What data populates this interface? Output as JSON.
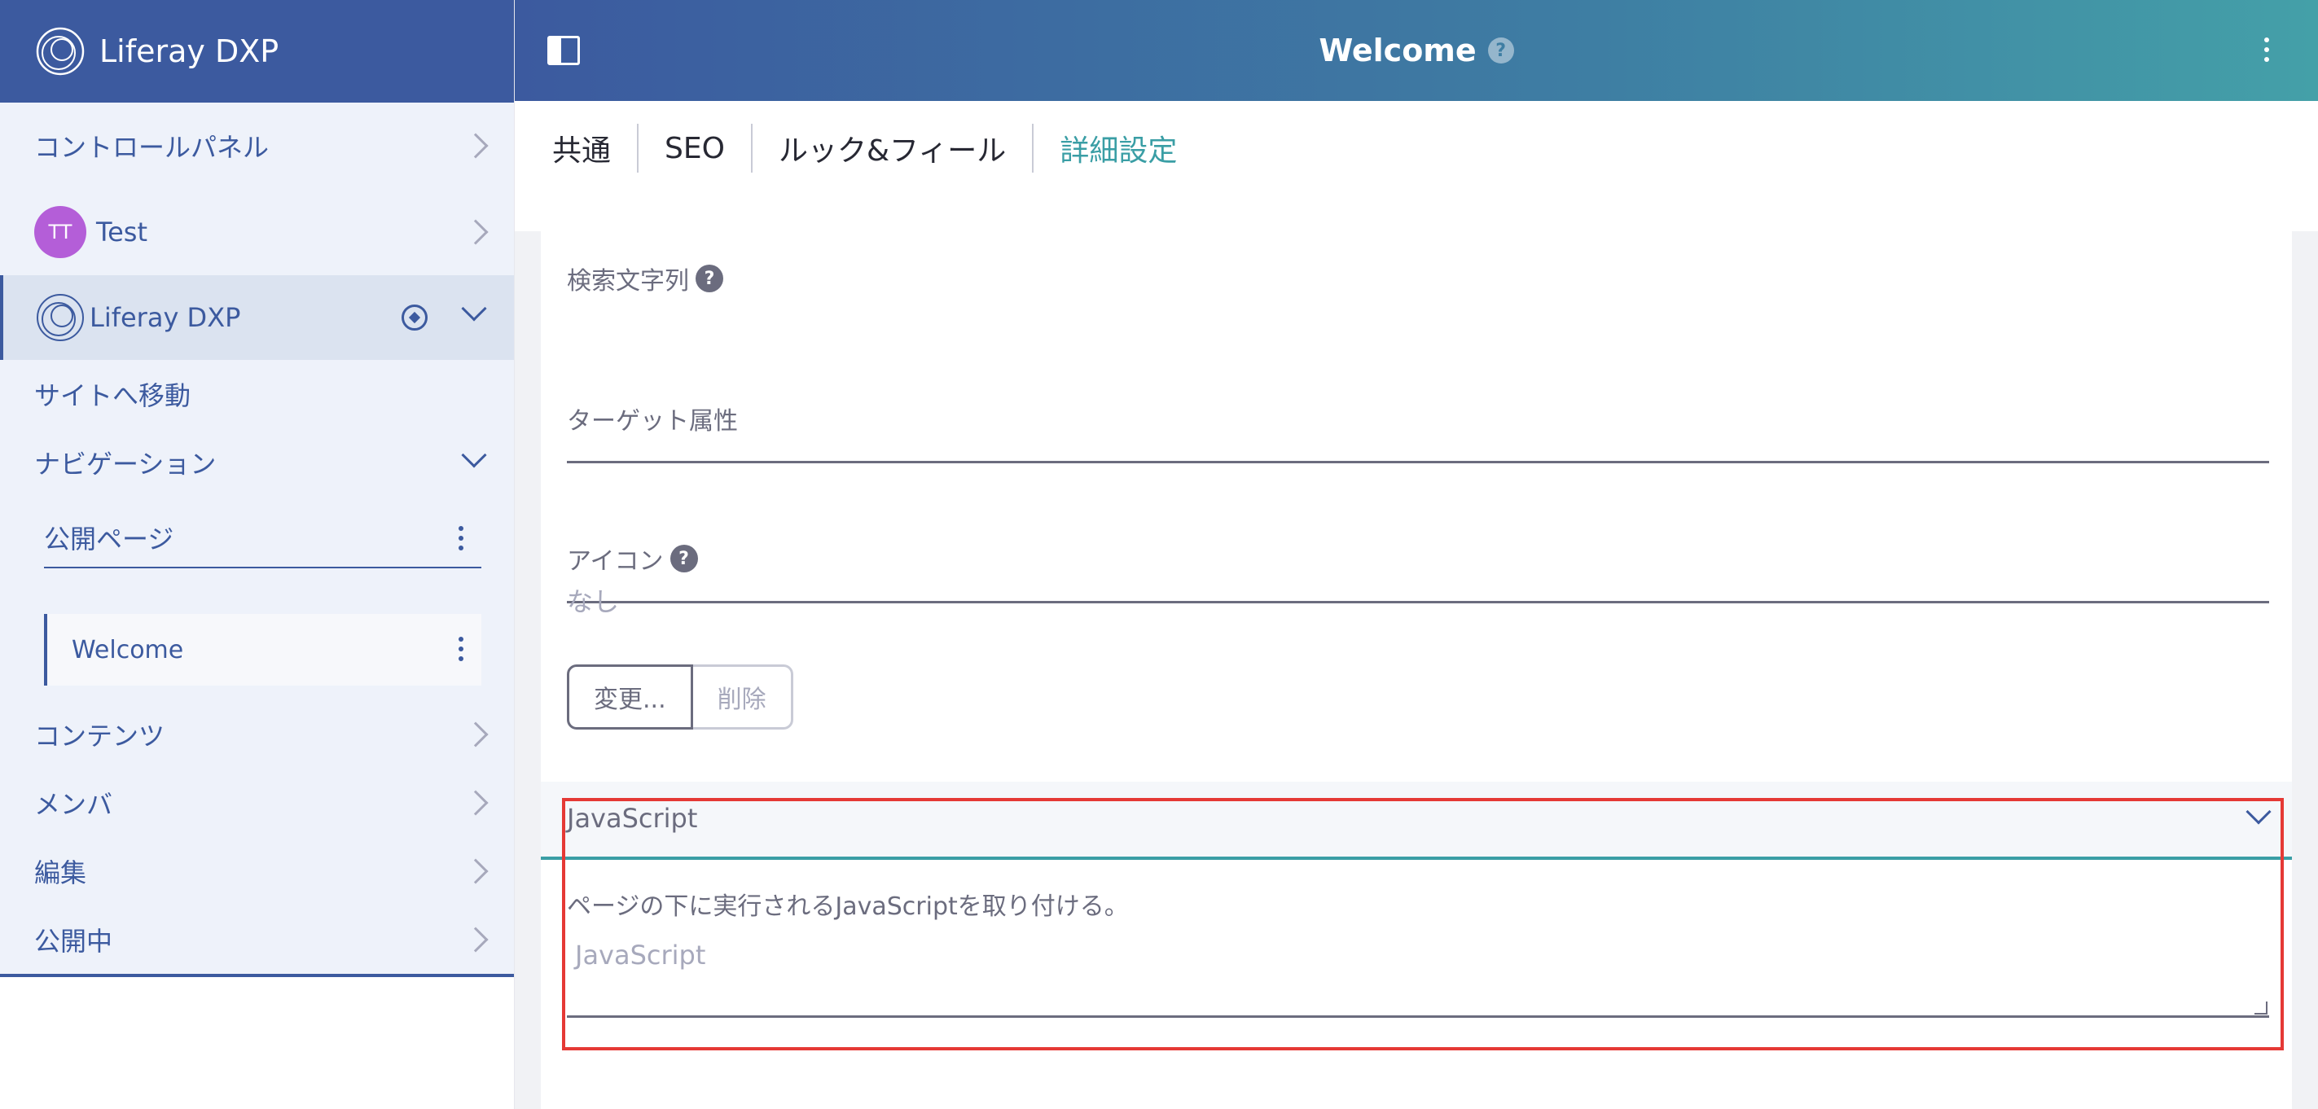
{
  "sidebar": {
    "brand": "Liferay DXP",
    "control_panel": "コントロールパネル",
    "user": {
      "initials": "TT",
      "name": "Test"
    },
    "site": {
      "name": "Liferay DXP"
    },
    "go_to_site": "サイトへ移動",
    "navigation": "ナビゲーション",
    "public_pages": "公開ページ",
    "pages": [
      {
        "label": "Welcome"
      }
    ],
    "items": [
      {
        "label": "コンテンツ"
      },
      {
        "label": "メンバ"
      },
      {
        "label": "編集"
      },
      {
        "label": "公開中"
      }
    ]
  },
  "topbar": {
    "title": "Welcome",
    "help": "?"
  },
  "tabs": [
    {
      "label": "共通"
    },
    {
      "label": "SEO"
    },
    {
      "label": "ルック&フィール"
    },
    {
      "label": "詳細設定",
      "active": true
    }
  ],
  "form": {
    "query_string_label": "検索文字列",
    "target_label": "ターゲット属性",
    "icon_label": "アイコン",
    "icon_value": "なし",
    "change_button": "変更...",
    "delete_button": "削除",
    "help": "?"
  },
  "javascript_panel": {
    "title": "JavaScript",
    "description": "ページの下に実行されるJavaScriptを取り付ける。",
    "placeholder": "JavaScript"
  },
  "colors": {
    "primary": "#3c5a9f",
    "accent": "#3a9ea5",
    "highlight": "#e53935",
    "avatar": "#b45ed8"
  }
}
